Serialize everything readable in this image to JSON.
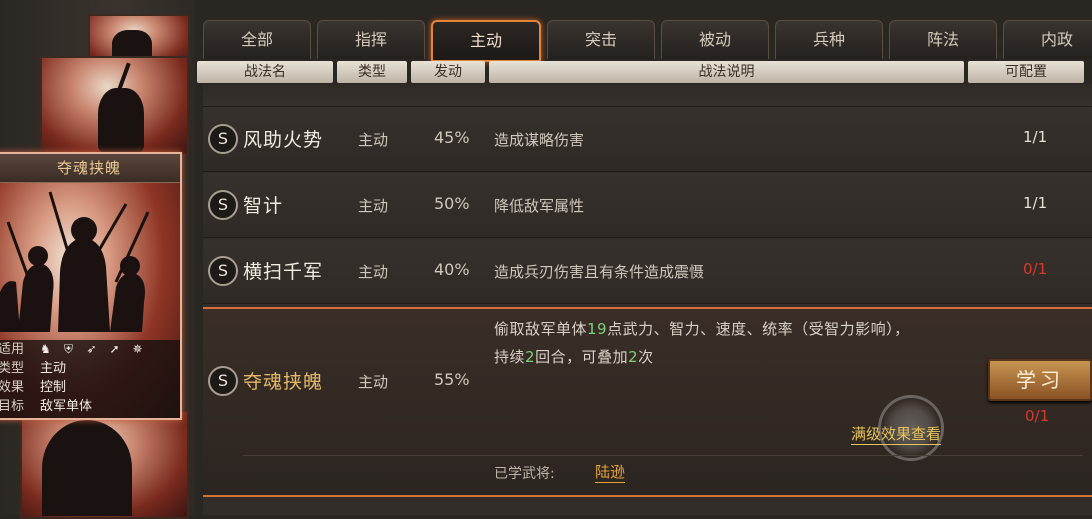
{
  "tabs": [
    {
      "label": "全部"
    },
    {
      "label": "指挥"
    },
    {
      "label": "主动"
    },
    {
      "label": "突击"
    },
    {
      "label": "被动"
    },
    {
      "label": "兵种"
    },
    {
      "label": "阵法"
    },
    {
      "label": "内政"
    }
  ],
  "active_tab_index": 2,
  "columns": {
    "name": "战法名",
    "type": "类型",
    "rate": "发动",
    "desc": "战法说明",
    "config": "可配置"
  },
  "skills": [
    {
      "badge": "S",
      "name": "风助火势",
      "type": "主动",
      "rate": "45%",
      "desc": "造成谋略伤害",
      "config": "1/1",
      "config_color": "#e6e0d6"
    },
    {
      "badge": "S",
      "name": "智计",
      "type": "主动",
      "rate": "50%",
      "desc": "降低敌军属性",
      "config": "1/1",
      "config_color": "#e6e0d6"
    },
    {
      "badge": "S",
      "name": "横扫千军",
      "type": "主动",
      "rate": "40%",
      "desc": "造成兵刃伤害且有条件造成震慑",
      "config": "0/1",
      "config_color": "#d43a2a"
    }
  ],
  "selected_skill": {
    "badge": "S",
    "name": "夺魂挟魄",
    "type": "主动",
    "rate": "55%",
    "desc_part1": "偷取敌军单体",
    "desc_num1": "19",
    "desc_part2": "点武力、智力、速度、统率（受智力影响），持续",
    "desc_num2": "2",
    "desc_part3": "回合，可叠加",
    "desc_num3": "2",
    "desc_part4": "次",
    "learn_button": "学习",
    "config": "0/1",
    "max_effect_link": "满级效果查看",
    "learned_label": "已学武将:",
    "learned_general": "陆逊"
  },
  "card": {
    "title": "夺魂挟魄",
    "rows": [
      {
        "key": "适用",
        "value": ""
      },
      {
        "key": "类型",
        "value": "主动"
      },
      {
        "key": "效果",
        "value": "控制"
      },
      {
        "key": "目标",
        "value": "敌军单体"
      }
    ],
    "troop_icons": [
      "cavalry-icon",
      "shield-icon",
      "bow-icon",
      "spear-icon",
      "wheel-icon"
    ]
  }
}
